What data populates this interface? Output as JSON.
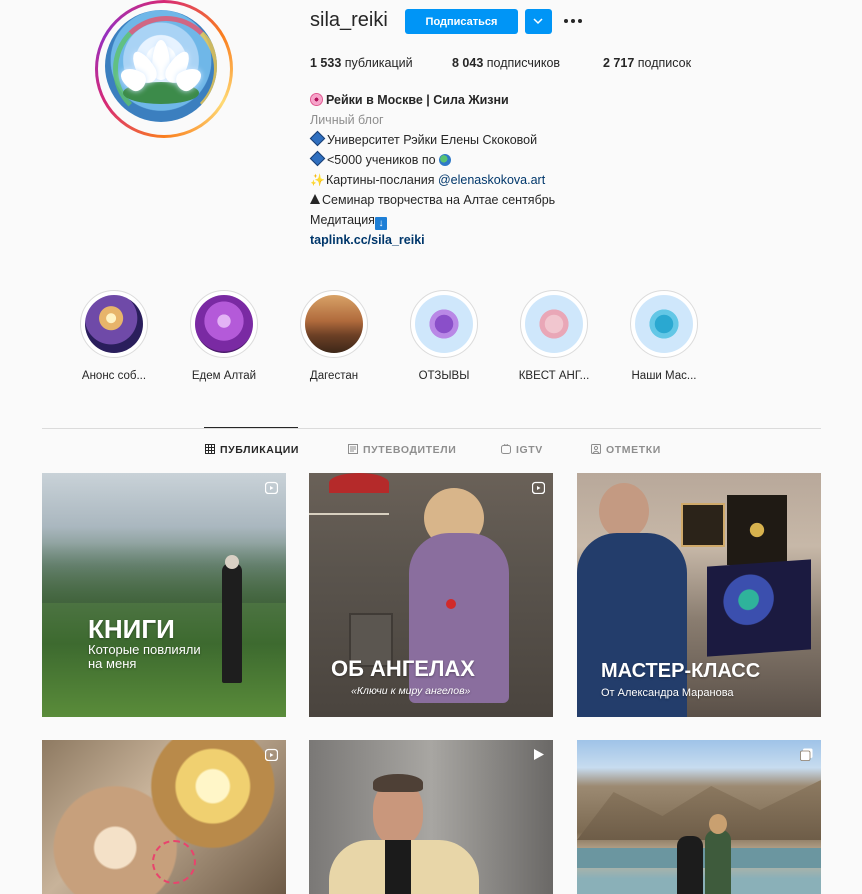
{
  "profile": {
    "username": "sila_reiki",
    "follow_label": "Подписаться",
    "stats": {
      "posts": "1 533",
      "posts_label": "публикаций",
      "followers": "8 043",
      "followers_label": "подписчиков",
      "following": "2 717",
      "following_label": "подписок"
    },
    "bio": {
      "name": "Рейки в Москве | Сила Жизни",
      "category": "Личный блог",
      "line1": "Университет Рэйки Елены Скоковой",
      "line2": "<5000 учеников по",
      "line3_prefix": "Картины-послания",
      "line3_mention": "@elenaskokova.art",
      "line4": "Семинар творчества на Алтае сентябрь",
      "line5": "Медитация",
      "link": "taplink.cc/sila_reiki"
    }
  },
  "highlights": [
    {
      "label": "Анонс соб..."
    },
    {
      "label": "Едем Алтай"
    },
    {
      "label": "Дагестан"
    },
    {
      "label": "ОТЗЫВЫ"
    },
    {
      "label": "КВЕСТ АНГ..."
    },
    {
      "label": "Наши Мас..."
    }
  ],
  "tabs": [
    {
      "label": "ПУБЛИКАЦИИ",
      "active": true,
      "icon": "grid-icon"
    },
    {
      "label": "ПУТЕВОДИТЕЛИ",
      "active": false,
      "icon": "guide-icon"
    },
    {
      "label": "IGTV",
      "active": false,
      "icon": "igtv-icon"
    },
    {
      "label": "ОТМЕТКИ",
      "active": false,
      "icon": "tagged-icon"
    }
  ],
  "posts": [
    {
      "title": "КНИГИ",
      "subtitle": "Которые повлияли\nна меня",
      "badge": "reels-icon"
    },
    {
      "title": "ОБ АНГЕЛАХ",
      "subtitle": "«Ключи к миру ангелов»",
      "badge": "reels-icon"
    },
    {
      "title": "МАСТЕР-КЛАСС",
      "subtitle": "От Александра Маранова",
      "badge": "none"
    },
    {
      "title": "",
      "subtitle": "",
      "badge": "reels-icon"
    },
    {
      "title": "",
      "subtitle": "",
      "badge": "video-icon"
    },
    {
      "title": "",
      "subtitle": "",
      "badge": "carousel-icon"
    }
  ],
  "colors": {
    "accent": "#0095f6",
    "link": "#00376b",
    "muted": "#8e8e8e"
  }
}
